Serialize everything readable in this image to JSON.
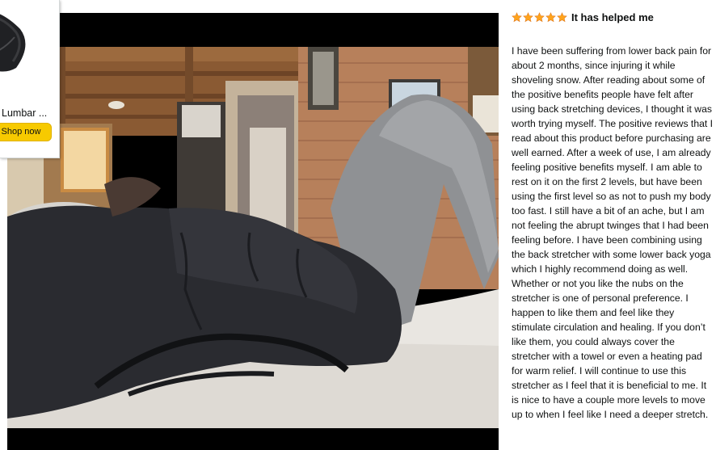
{
  "ad_card": {
    "product_title": "Lumbar ...",
    "shop_button_label": "Shop now",
    "button_color": "#f7ca00"
  },
  "video": {
    "icon": "video-player"
  },
  "review": {
    "rating": 5,
    "rating_max": 5,
    "star_color": "#ffa41c",
    "title": "It has helped me",
    "body": "I have been suffering from lower back pain for about 2 months, since injuring it while shoveling snow. After reading about some of the positive benefits people have felt after using back stretching devices, I thought it was worth trying myself. The positive reviews that I read about this product before purchasing are well earned. After a week of use, I am already feeling positive benefits myself. I am able to rest on it on the first 2 levels, but have been using the first level so as not to push my body too fast. I still have a bit of an ache, but I am not feeling the abrupt twinges that I had been feeling before. I have been combining using the back stretcher with some lower back yoga which I highly recommend doing as well. Whether or not you like the nubs on the stretcher is one of personal preference. I happen to like them and feel like they stimulate circulation and healing. If you don’t like them, you could always cover the stretcher with a towel or even a heating pad for warm relief. I will continue to use this stretcher as I feel that it is beneficial to me. It is nice to have a couple more levels to move up to when I feel like I need a deeper stretch."
  }
}
